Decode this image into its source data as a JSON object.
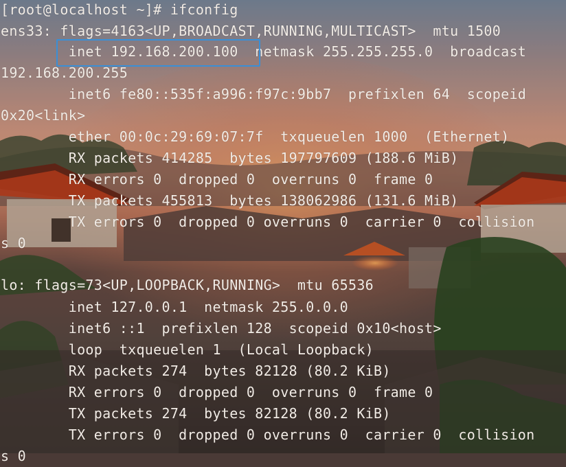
{
  "terminal": {
    "lines": [
      "[root@localhost ~]# ifconfig",
      "ens33: flags=4163<UP,BROADCAST,RUNNING,MULTICAST>  mtu 1500",
      "        inet 192.168.200.100  netmask 255.255.255.0  broadcast",
      "192.168.200.255",
      "        inet6 fe80::535f:a996:f97c:9bb7  prefixlen 64  scopeid",
      "0x20<link>",
      "        ether 00:0c:29:69:07:7f  txqueuelen 1000  (Ethernet)",
      "        RX packets 414285  bytes 197797609 (188.6 MiB)",
      "        RX errors 0  dropped 0  overruns 0  frame 0",
      "        TX packets 455813  bytes 138062986 (131.6 MiB)",
      "        TX errors 0  dropped 0 overruns 0  carrier 0  collision",
      "s 0",
      "",
      "lo: flags=73<UP,LOOPBACK,RUNNING>  mtu 65536",
      "        inet 127.0.0.1  netmask 255.0.0.0",
      "        inet6 ::1  prefixlen 128  scopeid 0x10<host>",
      "        loop  txqueuelen 1  (Local Loopback)",
      "        RX packets 274  bytes 82128 (80.2 KiB)",
      "        RX errors 0  dropped 0  overruns 0  frame 0",
      "        TX packets 274  bytes 82128 (80.2 KiB)",
      "        TX errors 0  dropped 0 overruns 0  carrier 0  collision",
      "s 0"
    ]
  },
  "highlight": {
    "color": "#3a8fd6"
  },
  "colors": {
    "text": "#f2ece6",
    "sky_top": "#7c8a9e",
    "sky_mid": "#d89a7e",
    "sky_glow": "#f0a060",
    "roof_red": "#c2401e",
    "foliage": "#3e5a2c"
  }
}
